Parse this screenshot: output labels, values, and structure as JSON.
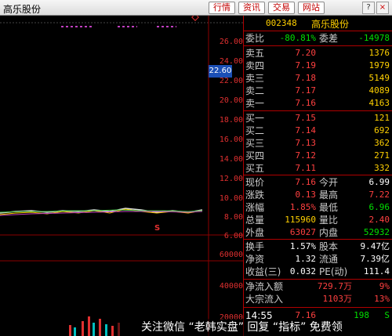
{
  "window": {
    "title": "高乐股份",
    "toolbar": [
      "行情",
      "资讯",
      "交易",
      "网站"
    ],
    "controls": {
      "help": "?",
      "close": "×"
    }
  },
  "chart": {
    "price_badge": "22.60",
    "price_axis": [
      "26.00",
      "24.00",
      "22.00",
      "20.00",
      "18.00",
      "16.00",
      "14.00",
      "12.00",
      "10.00",
      "8.00",
      "6.00"
    ],
    "volume_axis": [
      "60000",
      "40000",
      "20000"
    ],
    "marker": "S"
  },
  "stock": {
    "code": "002348",
    "name": "高乐股份"
  },
  "committee": {
    "ratio_label": "委比",
    "ratio": "-80.81%",
    "diff_label": "委差",
    "diff": "-14978"
  },
  "sell": [
    {
      "label": "卖五",
      "price": "7.20",
      "vol": "1376"
    },
    {
      "label": "卖四",
      "price": "7.19",
      "vol": "1979"
    },
    {
      "label": "卖三",
      "price": "7.18",
      "vol": "5149"
    },
    {
      "label": "卖二",
      "price": "7.17",
      "vol": "4089"
    },
    {
      "label": "卖一",
      "price": "7.16",
      "vol": "4163"
    }
  ],
  "buy": [
    {
      "label": "买一",
      "price": "7.15",
      "vol": "121"
    },
    {
      "label": "买二",
      "price": "7.14",
      "vol": "692"
    },
    {
      "label": "买三",
      "price": "7.13",
      "vol": "362"
    },
    {
      "label": "买四",
      "price": "7.12",
      "vol": "271"
    },
    {
      "label": "买五",
      "price": "7.11",
      "vol": "332"
    }
  ],
  "quote": [
    {
      "l1": "现价",
      "v1": "7.16",
      "l2": "今开",
      "v2": "6.99"
    },
    {
      "l1": "涨跌",
      "v1": "0.13",
      "l2": "最高",
      "v2": "7.22"
    },
    {
      "l1": "涨幅",
      "v1": "1.85%",
      "l2": "最低",
      "v2": "6.96"
    },
    {
      "l1": "总量",
      "v1": "115960",
      "l2": "量比",
      "v2": "2.40"
    },
    {
      "l1": "外盘",
      "v1": "63027",
      "l2": "内盘",
      "v2": "52932"
    }
  ],
  "finance": [
    {
      "l1": "换手",
      "v1": "1.57%",
      "l2": "股本",
      "v2": "9.47亿"
    },
    {
      "l1": "净资",
      "v1": "1.32",
      "l2": "流通",
      "v2": "7.39亿"
    },
    {
      "l1": "收益(三)",
      "v1": "0.032",
      "l2": "PE(动)",
      "v2": "111.4"
    }
  ],
  "flow": [
    {
      "label": "净流入额",
      "amount": "729.7万",
      "pct": "9%"
    },
    {
      "label": "大宗流入",
      "amount": "1103万",
      "pct": "13%"
    }
  ],
  "tick": {
    "time": "14:55",
    "price": "7.16",
    "vol": "198",
    "flag": "S"
  },
  "watermark": "关注微信 “老韩实盘” 回复 “指标” 免费领"
}
